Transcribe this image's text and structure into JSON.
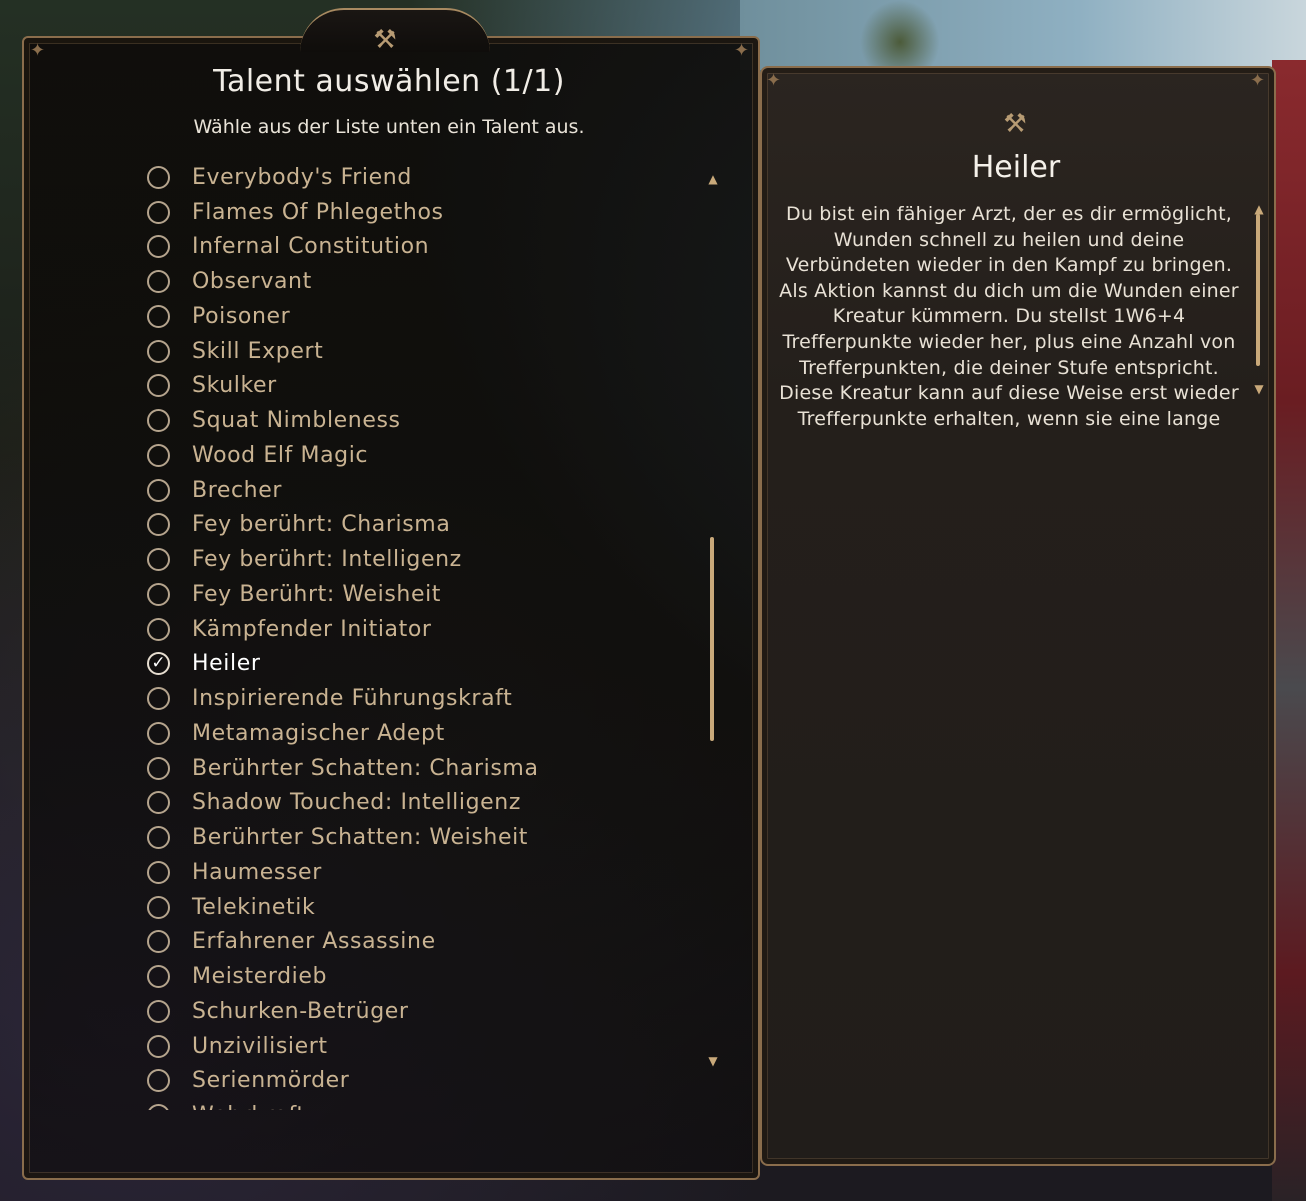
{
  "dialog": {
    "title": "Talent auswählen (1/1)",
    "subtitle": "Wähle aus der Liste unten ein Talent aus."
  },
  "icons": {
    "crest": "crossed-hammers-icon",
    "radio": "radio-circle",
    "check": "checkmark-icon",
    "scroll_up": "arrow-up-icon",
    "scroll_down": "arrow-down-icon"
  },
  "feats": [
    {
      "label": "Everybody's Friend",
      "selected": false
    },
    {
      "label": "Flames Of Phlegethos",
      "selected": false
    },
    {
      "label": "Infernal Constitution",
      "selected": false
    },
    {
      "label": "Observant",
      "selected": false
    },
    {
      "label": "Poisoner",
      "selected": false
    },
    {
      "label": "Skill Expert",
      "selected": false
    },
    {
      "label": "Skulker",
      "selected": false
    },
    {
      "label": "Squat Nimbleness",
      "selected": false
    },
    {
      "label": "Wood Elf Magic",
      "selected": false
    },
    {
      "label": "Brecher",
      "selected": false
    },
    {
      "label": "Fey berührt: Charisma",
      "selected": false
    },
    {
      "label": "Fey berührt: Intelligenz",
      "selected": false
    },
    {
      "label": "Fey Berührt: Weisheit",
      "selected": false
    },
    {
      "label": "Kämpfender Initiator",
      "selected": false
    },
    {
      "label": "Heiler",
      "selected": true
    },
    {
      "label": "Inspirierende Führungskraft",
      "selected": false
    },
    {
      "label": "Metamagischer Adept",
      "selected": false
    },
    {
      "label": "Berührter Schatten: Charisma",
      "selected": false
    },
    {
      "label": "Shadow Touched: Intelligenz",
      "selected": false
    },
    {
      "label": "Berührter Schatten: Weisheit",
      "selected": false
    },
    {
      "label": "Haumesser",
      "selected": false
    },
    {
      "label": "Telekinetik",
      "selected": false
    },
    {
      "label": "Erfahrener Assassine",
      "selected": false
    },
    {
      "label": "Meisterdieb",
      "selected": false
    },
    {
      "label": "Schurken-Betrüger",
      "selected": false
    },
    {
      "label": "Unzivilisiert",
      "selected": false
    },
    {
      "label": "Serienmörder",
      "selected": false
    },
    {
      "label": "Wehrkraft",
      "selected": false
    }
  ],
  "detail": {
    "title": "Heiler",
    "description": "Du bist ein fähiger Arzt, der es dir ermöglicht, Wunden schnell zu heilen und deine Verbündeten wieder in den Kampf zu bringen. Als Aktion kannst du dich um die Wunden einer Kreatur kümmern. Du stellst 1W6+4 Trefferpunkte wieder her, plus eine Anzahl von Trefferpunkten, die deiner Stufe entspricht. Diese Kreatur kann auf diese Weise erst wieder Trefferpunkte erhalten, wenn sie eine lange"
  },
  "colors": {
    "panel_border": "#8a6d4c",
    "item_text": "#c9b392",
    "selected_text": "#ffffff",
    "accent": "#c9a97a"
  }
}
